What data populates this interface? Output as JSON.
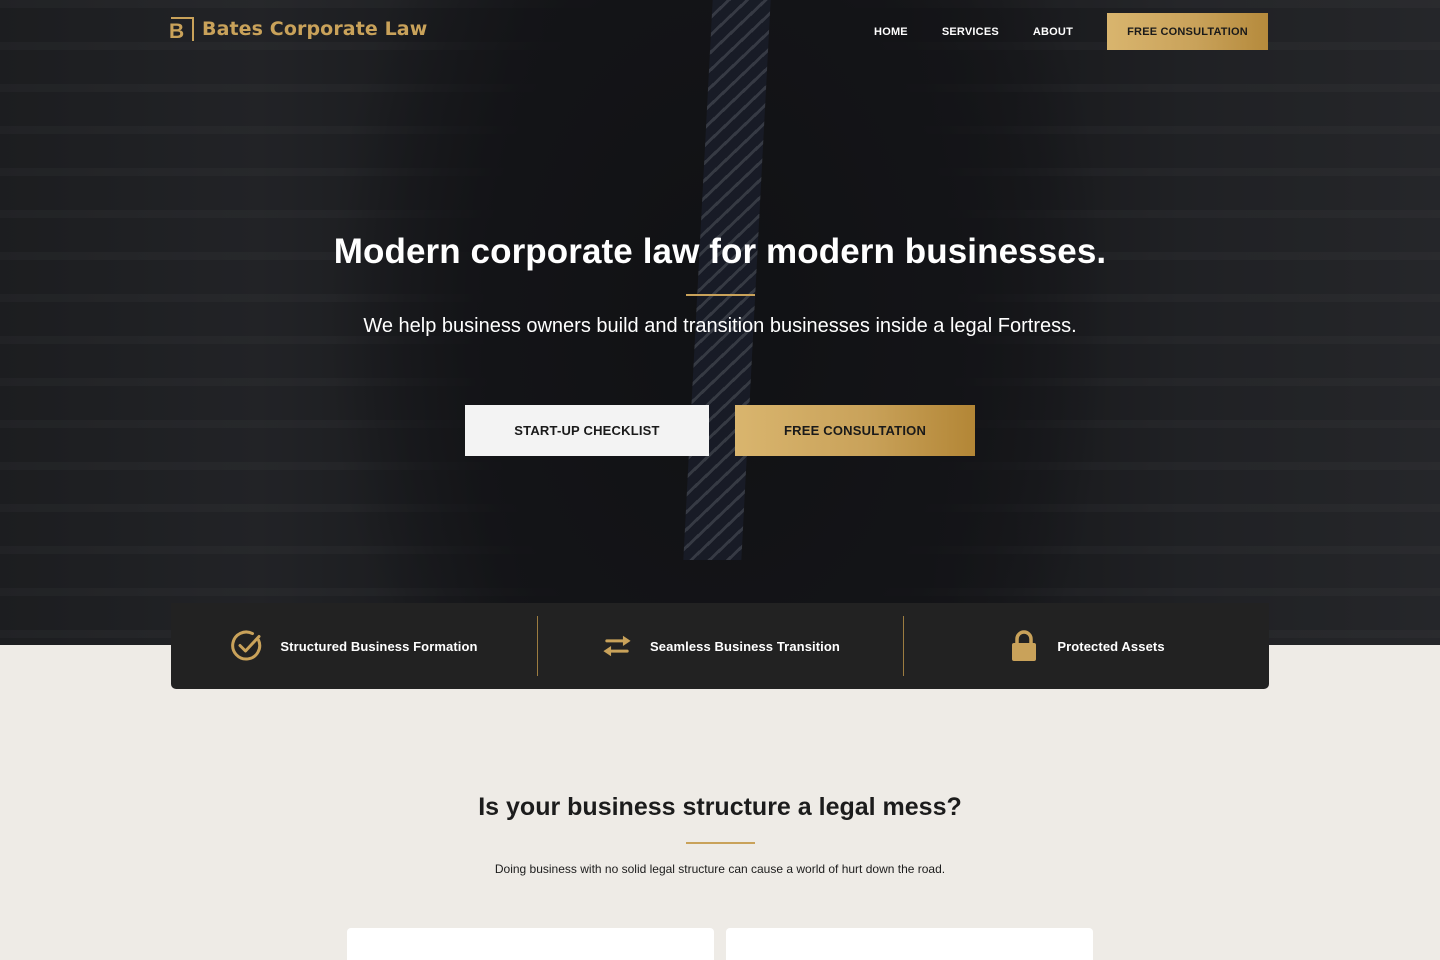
{
  "brand": {
    "logo_letter": "B",
    "name": "Bates Corporate Law",
    "accent_color": "#c9a25a"
  },
  "nav": {
    "items": [
      {
        "label": "HOME"
      },
      {
        "label": "SERVICES"
      },
      {
        "label": "ABOUT"
      }
    ],
    "cta_label": "FREE CONSULTATION"
  },
  "hero": {
    "title": "Modern corporate law for modern businesses.",
    "subtitle": "We help business owners build and transition businesses inside a legal Fortress.",
    "primary_button": "START-UP CHECKLIST",
    "secondary_button": "FREE CONSULTATION"
  },
  "features": [
    {
      "icon": "check-circle-icon",
      "label": "Structured Business Formation"
    },
    {
      "icon": "swap-arrows-icon",
      "label": "Seamless Business Transition"
    },
    {
      "icon": "lock-icon",
      "label": "Protected Assets"
    }
  ],
  "section": {
    "title": "Is your business structure a legal mess?",
    "subtitle": "Doing business with no solid legal structure can cause a world of hurt down the road."
  }
}
